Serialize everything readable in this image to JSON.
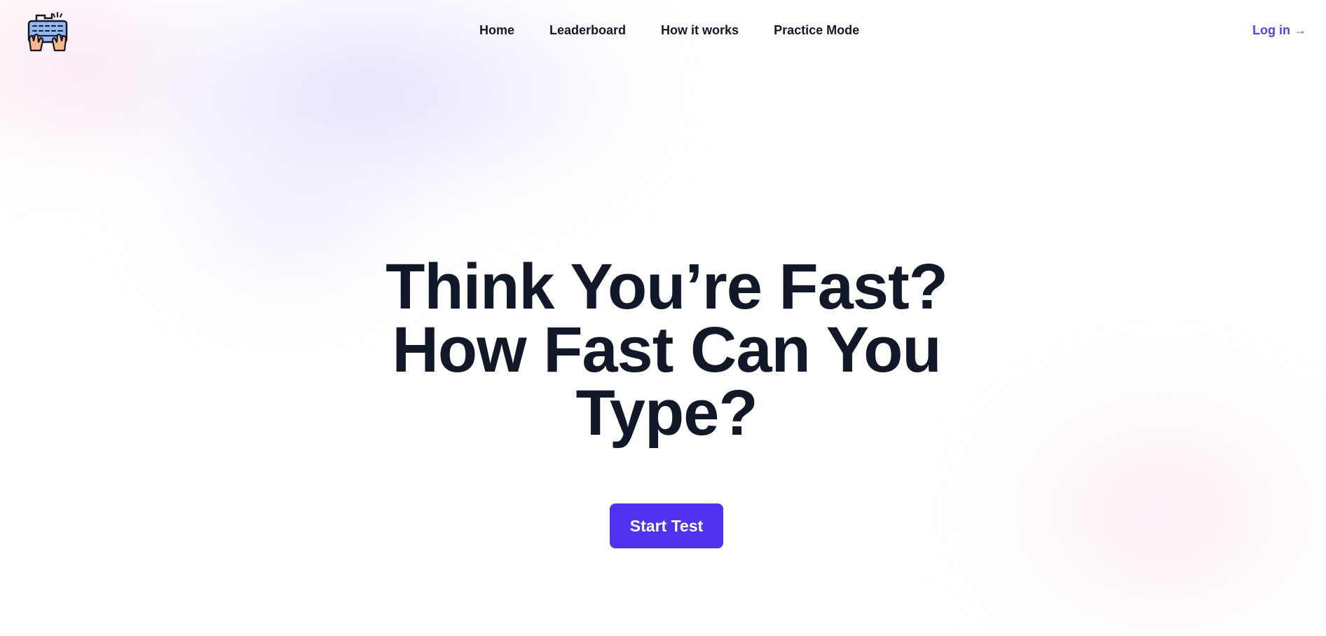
{
  "header": {
    "logo_icon": "keyboard-hands-icon",
    "nav": [
      {
        "label": "Home"
      },
      {
        "label": "Leaderboard"
      },
      {
        "label": "How it works"
      },
      {
        "label": "Practice Mode"
      }
    ],
    "login_label": "Log in →"
  },
  "hero": {
    "title": "Think You’re Fast? How Fast Can You Type?",
    "cta_label": "Start Test"
  },
  "colors": {
    "text": "#111827",
    "accent": "#4f46e5",
    "button": "#4f33f0"
  }
}
